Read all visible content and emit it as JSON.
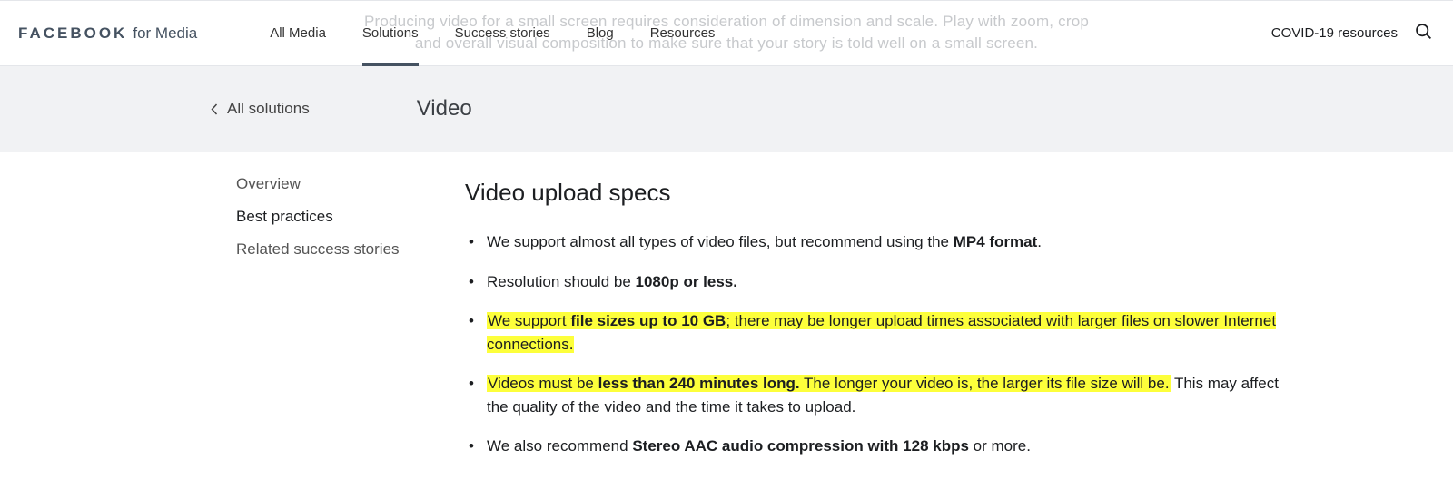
{
  "ghost": {
    "l1": "Producing video for a small screen requires consideration of dimension and scale. Play with zoom, crop",
    "l2": "and overall visual composition to make sure that your story is told well on a small screen."
  },
  "brand": {
    "main": "FACEBOOK",
    "sub": "for Media"
  },
  "nav": {
    "items": [
      {
        "label": "All Media"
      },
      {
        "label": "Solutions"
      },
      {
        "label": "Success stories"
      },
      {
        "label": "Blog"
      },
      {
        "label": "Resources"
      }
    ],
    "right": "COVID-19 resources"
  },
  "band": {
    "back": "All solutions",
    "title": "Video"
  },
  "sidenav": [
    {
      "label": "Overview"
    },
    {
      "label": "Best practices"
    },
    {
      "label": "Related success stories"
    }
  ],
  "section": {
    "heading": "Video upload specs"
  },
  "specs": {
    "i0": {
      "a": "We support almost all types of video files, but recommend using the ",
      "b": "MP4 format",
      "c": "."
    },
    "i1": {
      "a": "Resolution should be ",
      "b": "1080p or less."
    },
    "i2": {
      "a": "We support ",
      "b": "file sizes up to 10 GB",
      "c": "; there may be longer upload times associated with larger files on slower Internet connections."
    },
    "i3": {
      "a": "Videos must be ",
      "b": "less than 240 minutes long.",
      "c": " The longer your video is, the larger its file size will be.",
      "d": " This may affect the quality of the video and the time it takes to upload."
    },
    "i4": {
      "a": "We also recommend ",
      "b": "Stereo AAC audio compression with 128 kbps",
      "c": " or more."
    }
  }
}
